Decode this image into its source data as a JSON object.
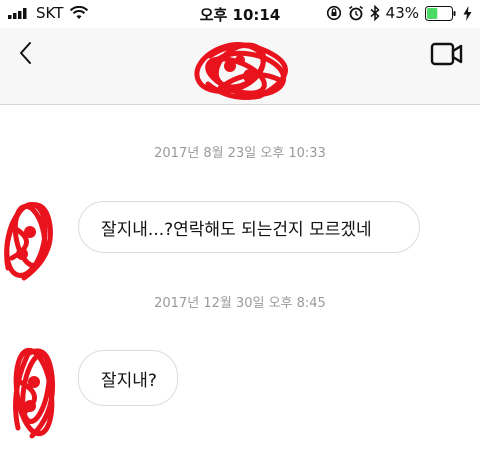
{
  "status_bar": {
    "carrier": "SKT",
    "time": "오후 10:14",
    "battery_percent_label": "43%",
    "battery_level": 0.43,
    "battery_color": "#4cd964"
  },
  "nav": {
    "back_icon": "chevron-left-icon",
    "video_icon": "video-camera-icon"
  },
  "messages": [
    {
      "timestamp": "2017년 8월 23일 오후 10:33",
      "text": "잘지내...?연락해도 되는건지 모르겠네"
    },
    {
      "timestamp": "2017년 12월 30일 오후 8:45",
      "text": "잘지내?"
    }
  ],
  "redaction_color": "#e8131c"
}
